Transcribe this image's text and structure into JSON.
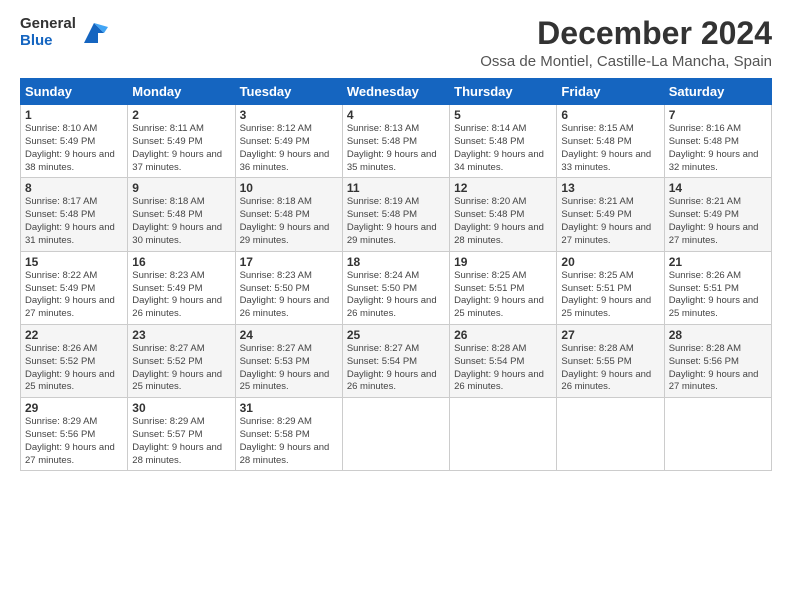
{
  "header": {
    "logo_general": "General",
    "logo_blue": "Blue",
    "month_title": "December 2024",
    "location": "Ossa de Montiel, Castille-La Mancha, Spain"
  },
  "weekdays": [
    "Sunday",
    "Monday",
    "Tuesday",
    "Wednesday",
    "Thursday",
    "Friday",
    "Saturday"
  ],
  "weeks": [
    [
      {
        "day": "1",
        "sunrise": "8:10 AM",
        "sunset": "5:49 PM",
        "daylight": "9 hours and 38 minutes."
      },
      {
        "day": "2",
        "sunrise": "8:11 AM",
        "sunset": "5:49 PM",
        "daylight": "9 hours and 37 minutes."
      },
      {
        "day": "3",
        "sunrise": "8:12 AM",
        "sunset": "5:49 PM",
        "daylight": "9 hours and 36 minutes."
      },
      {
        "day": "4",
        "sunrise": "8:13 AM",
        "sunset": "5:48 PM",
        "daylight": "9 hours and 35 minutes."
      },
      {
        "day": "5",
        "sunrise": "8:14 AM",
        "sunset": "5:48 PM",
        "daylight": "9 hours and 34 minutes."
      },
      {
        "day": "6",
        "sunrise": "8:15 AM",
        "sunset": "5:48 PM",
        "daylight": "9 hours and 33 minutes."
      },
      {
        "day": "7",
        "sunrise": "8:16 AM",
        "sunset": "5:48 PM",
        "daylight": "9 hours and 32 minutes."
      }
    ],
    [
      {
        "day": "8",
        "sunrise": "8:17 AM",
        "sunset": "5:48 PM",
        "daylight": "9 hours and 31 minutes."
      },
      {
        "day": "9",
        "sunrise": "8:18 AM",
        "sunset": "5:48 PM",
        "daylight": "9 hours and 30 minutes."
      },
      {
        "day": "10",
        "sunrise": "8:18 AM",
        "sunset": "5:48 PM",
        "daylight": "9 hours and 29 minutes."
      },
      {
        "day": "11",
        "sunrise": "8:19 AM",
        "sunset": "5:48 PM",
        "daylight": "9 hours and 29 minutes."
      },
      {
        "day": "12",
        "sunrise": "8:20 AM",
        "sunset": "5:48 PM",
        "daylight": "9 hours and 28 minutes."
      },
      {
        "day": "13",
        "sunrise": "8:21 AM",
        "sunset": "5:49 PM",
        "daylight": "9 hours and 27 minutes."
      },
      {
        "day": "14",
        "sunrise": "8:21 AM",
        "sunset": "5:49 PM",
        "daylight": "9 hours and 27 minutes."
      }
    ],
    [
      {
        "day": "15",
        "sunrise": "8:22 AM",
        "sunset": "5:49 PM",
        "daylight": "9 hours and 27 minutes."
      },
      {
        "day": "16",
        "sunrise": "8:23 AM",
        "sunset": "5:49 PM",
        "daylight": "9 hours and 26 minutes."
      },
      {
        "day": "17",
        "sunrise": "8:23 AM",
        "sunset": "5:50 PM",
        "daylight": "9 hours and 26 minutes."
      },
      {
        "day": "18",
        "sunrise": "8:24 AM",
        "sunset": "5:50 PM",
        "daylight": "9 hours and 26 minutes."
      },
      {
        "day": "19",
        "sunrise": "8:25 AM",
        "sunset": "5:51 PM",
        "daylight": "9 hours and 25 minutes."
      },
      {
        "day": "20",
        "sunrise": "8:25 AM",
        "sunset": "5:51 PM",
        "daylight": "9 hours and 25 minutes."
      },
      {
        "day": "21",
        "sunrise": "8:26 AM",
        "sunset": "5:51 PM",
        "daylight": "9 hours and 25 minutes."
      }
    ],
    [
      {
        "day": "22",
        "sunrise": "8:26 AM",
        "sunset": "5:52 PM",
        "daylight": "9 hours and 25 minutes."
      },
      {
        "day": "23",
        "sunrise": "8:27 AM",
        "sunset": "5:52 PM",
        "daylight": "9 hours and 25 minutes."
      },
      {
        "day": "24",
        "sunrise": "8:27 AM",
        "sunset": "5:53 PM",
        "daylight": "9 hours and 25 minutes."
      },
      {
        "day": "25",
        "sunrise": "8:27 AM",
        "sunset": "5:54 PM",
        "daylight": "9 hours and 26 minutes."
      },
      {
        "day": "26",
        "sunrise": "8:28 AM",
        "sunset": "5:54 PM",
        "daylight": "9 hours and 26 minutes."
      },
      {
        "day": "27",
        "sunrise": "8:28 AM",
        "sunset": "5:55 PM",
        "daylight": "9 hours and 26 minutes."
      },
      {
        "day": "28",
        "sunrise": "8:28 AM",
        "sunset": "5:56 PM",
        "daylight": "9 hours and 27 minutes."
      }
    ],
    [
      {
        "day": "29",
        "sunrise": "8:29 AM",
        "sunset": "5:56 PM",
        "daylight": "9 hours and 27 minutes."
      },
      {
        "day": "30",
        "sunrise": "8:29 AM",
        "sunset": "5:57 PM",
        "daylight": "9 hours and 28 minutes."
      },
      {
        "day": "31",
        "sunrise": "8:29 AM",
        "sunset": "5:58 PM",
        "daylight": "9 hours and 28 minutes."
      },
      null,
      null,
      null,
      null
    ]
  ]
}
